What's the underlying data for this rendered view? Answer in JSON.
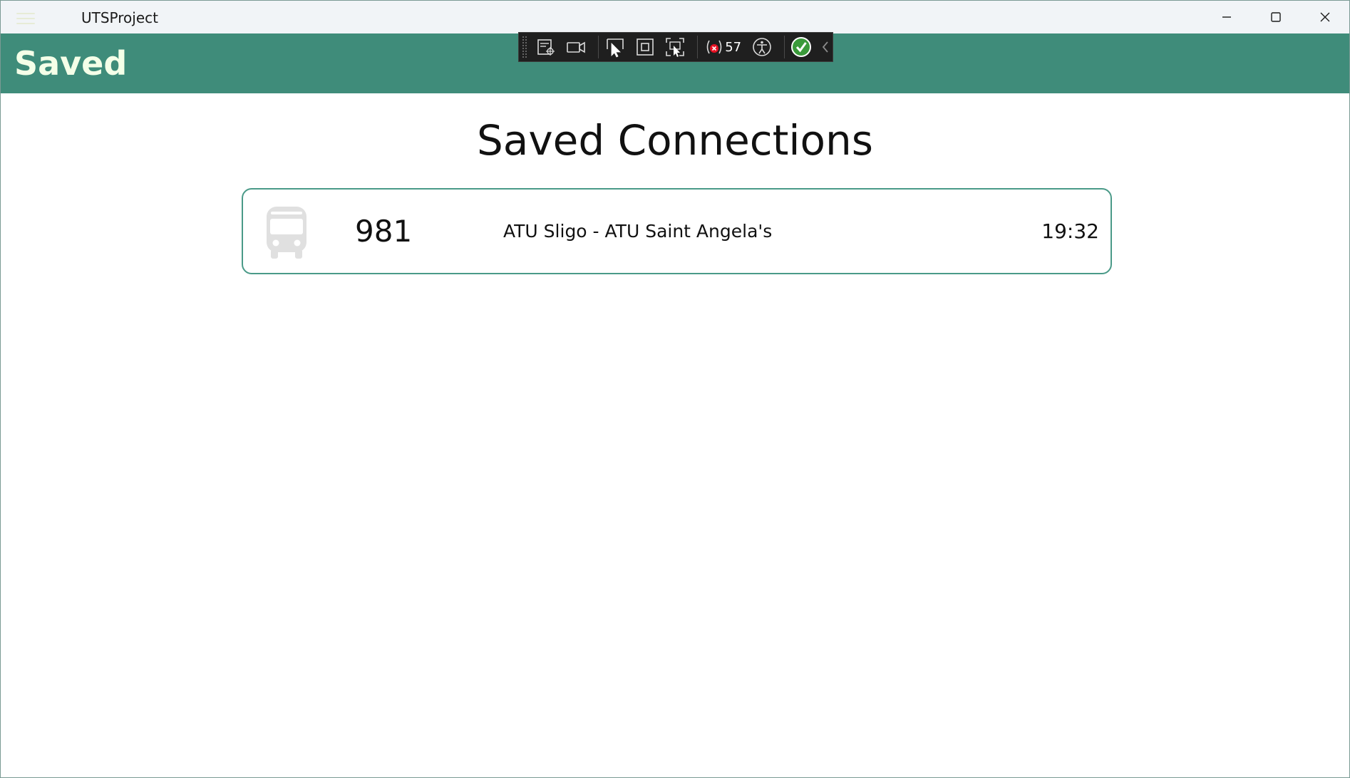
{
  "window": {
    "title": "UTSProject"
  },
  "appbar": {
    "title": "Saved"
  },
  "devtools": {
    "binding_failures_count": "57"
  },
  "page": {
    "heading": "Saved Connections",
    "connections": [
      {
        "icon": "bus-icon",
        "route_number": "981",
        "route_name": "ATU Sligo - ATU Saint Angela's",
        "time": "19:32"
      }
    ]
  },
  "colors": {
    "accent": "#3f8c7a",
    "appbar_title": "#f4ffe8",
    "card_border": "#4a9a88"
  }
}
